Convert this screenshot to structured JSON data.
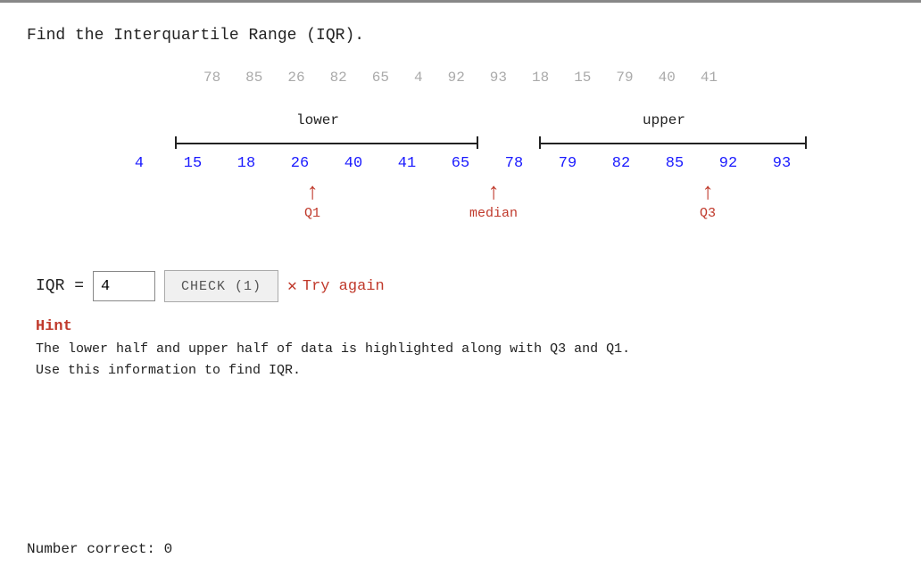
{
  "page": {
    "title": "Find the Interquartile Range (IQR).",
    "unordered_numbers": [
      "78",
      "85",
      "26",
      "82",
      "65",
      "4",
      "92",
      "93",
      "18",
      "15",
      "79",
      "40",
      "41"
    ],
    "bracket_lower_label": "lower",
    "bracket_upper_label": "upper",
    "sorted_numbers": [
      {
        "value": "4",
        "color": "blue"
      },
      {
        "value": "15",
        "color": "blue"
      },
      {
        "value": "18",
        "color": "blue"
      },
      {
        "value": "26",
        "color": "blue"
      },
      {
        "value": "40",
        "color": "blue"
      },
      {
        "value": "41",
        "color": "blue"
      },
      {
        "value": "65",
        "color": "blue"
      },
      {
        "value": "78",
        "color": "blue"
      },
      {
        "value": "79",
        "color": "blue"
      },
      {
        "value": "82",
        "color": "blue"
      },
      {
        "value": "85",
        "color": "blue"
      },
      {
        "value": "92",
        "color": "blue"
      },
      {
        "value": "93",
        "color": "blue"
      }
    ],
    "q1_label": "Q1",
    "median_label": "median",
    "q3_label": "Q3",
    "iqr_label": "IQR =",
    "input_value": "4",
    "check_button_label": "CHECK (1)",
    "try_again_label": "Try again",
    "hint_title": "Hint",
    "hint_line1": "The lower half and upper half of data is highlighted along with Q3 and Q1.",
    "hint_line2": "Use this information to find IQR.",
    "number_correct_label": "Number correct: 0"
  }
}
